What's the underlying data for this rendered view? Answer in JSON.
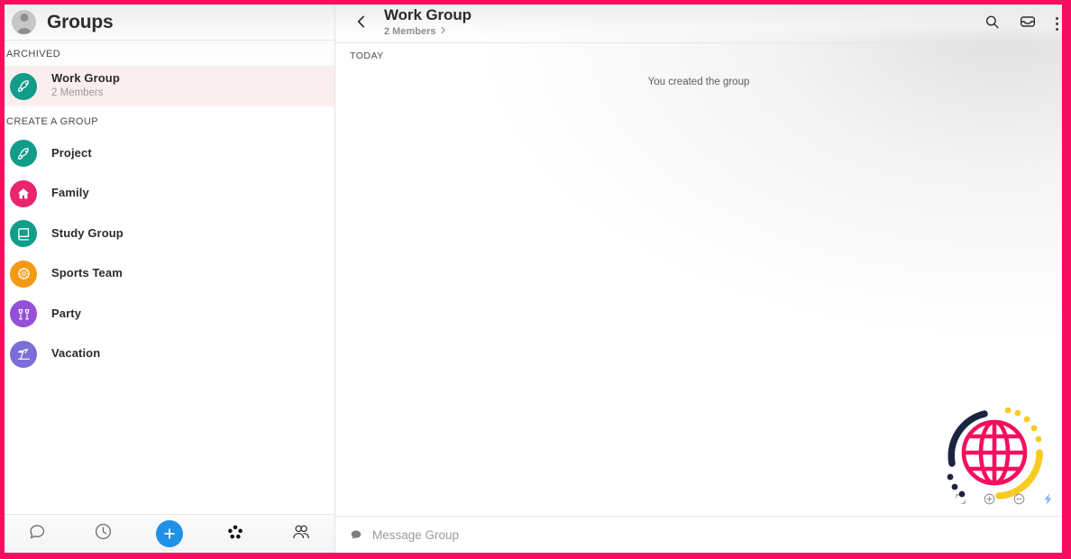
{
  "theme": {
    "frame_color": "#f50f5e",
    "accent_blue": "#1f91e8",
    "selected_row_bg": "#faeeee",
    "logo_pink": "#f50f5e",
    "logo_navy": "#1b2440",
    "logo_yellow": "#f7cb22"
  },
  "sidebar": {
    "title": "Groups",
    "avatar_icon": "person-avatar",
    "sections": [
      {
        "label": "ARCHIVED",
        "items": [
          {
            "name": "Work Group",
            "subtitle": "2 Members",
            "icon": "rocket-icon",
            "icon_color": "#129c8a",
            "selected": true
          }
        ]
      },
      {
        "label": "CREATE A GROUP",
        "items": [
          {
            "name": "Project",
            "icon": "rocket-icon",
            "icon_color": "#129c8a",
            "selected": false
          },
          {
            "name": "Family",
            "icon": "house-icon",
            "icon_color": "#e8256d",
            "selected": false
          },
          {
            "name": "Study Group",
            "icon": "book-icon",
            "icon_color": "#129c8a",
            "selected": false
          },
          {
            "name": "Sports Team",
            "icon": "ball-icon",
            "icon_color": "#f49a12",
            "selected": false
          },
          {
            "name": "Party",
            "icon": "cheers-icon",
            "icon_color": "#9450d6",
            "selected": false
          },
          {
            "name": "Vacation",
            "icon": "beach-icon",
            "icon_color": "#7a6fd6",
            "selected": false
          }
        ]
      }
    ],
    "bottom_nav": [
      {
        "icon": "chat-bubble-icon",
        "label": "Chats"
      },
      {
        "icon": "clock-icon",
        "label": "Recents"
      },
      {
        "icon": "plus-icon",
        "label": "New"
      },
      {
        "icon": "dots-cluster-icon",
        "label": "Groups"
      },
      {
        "icon": "people-icon",
        "label": "Contacts"
      }
    ]
  },
  "chat": {
    "back_icon": "chevron-left-icon",
    "title": "Work Group",
    "members_text": "2 Members",
    "members_chevron": "chevron-right-icon",
    "actions": [
      {
        "icon": "search-icon",
        "label": "Search"
      },
      {
        "icon": "inbox-icon",
        "label": "Archive"
      },
      {
        "icon": "kebab-menu-icon",
        "label": "More options"
      }
    ],
    "day_label": "TODAY",
    "messages": [
      {
        "type": "system",
        "text": "You created the group"
      }
    ],
    "composer": {
      "icon": "chat-bubble-icon",
      "placeholder": "Message Group",
      "value": ""
    }
  },
  "watermark": {
    "logo_icon": "globe-logo",
    "mini_toolbar": [
      {
        "icon": "expand-icon",
        "label": "Fullscreen"
      },
      {
        "icon": "zoom-in-icon",
        "label": "Zoom in"
      },
      {
        "icon": "zoom-out-icon",
        "label": "Zoom out"
      },
      {
        "icon": "lightning-icon",
        "label": "Boost"
      }
    ]
  }
}
